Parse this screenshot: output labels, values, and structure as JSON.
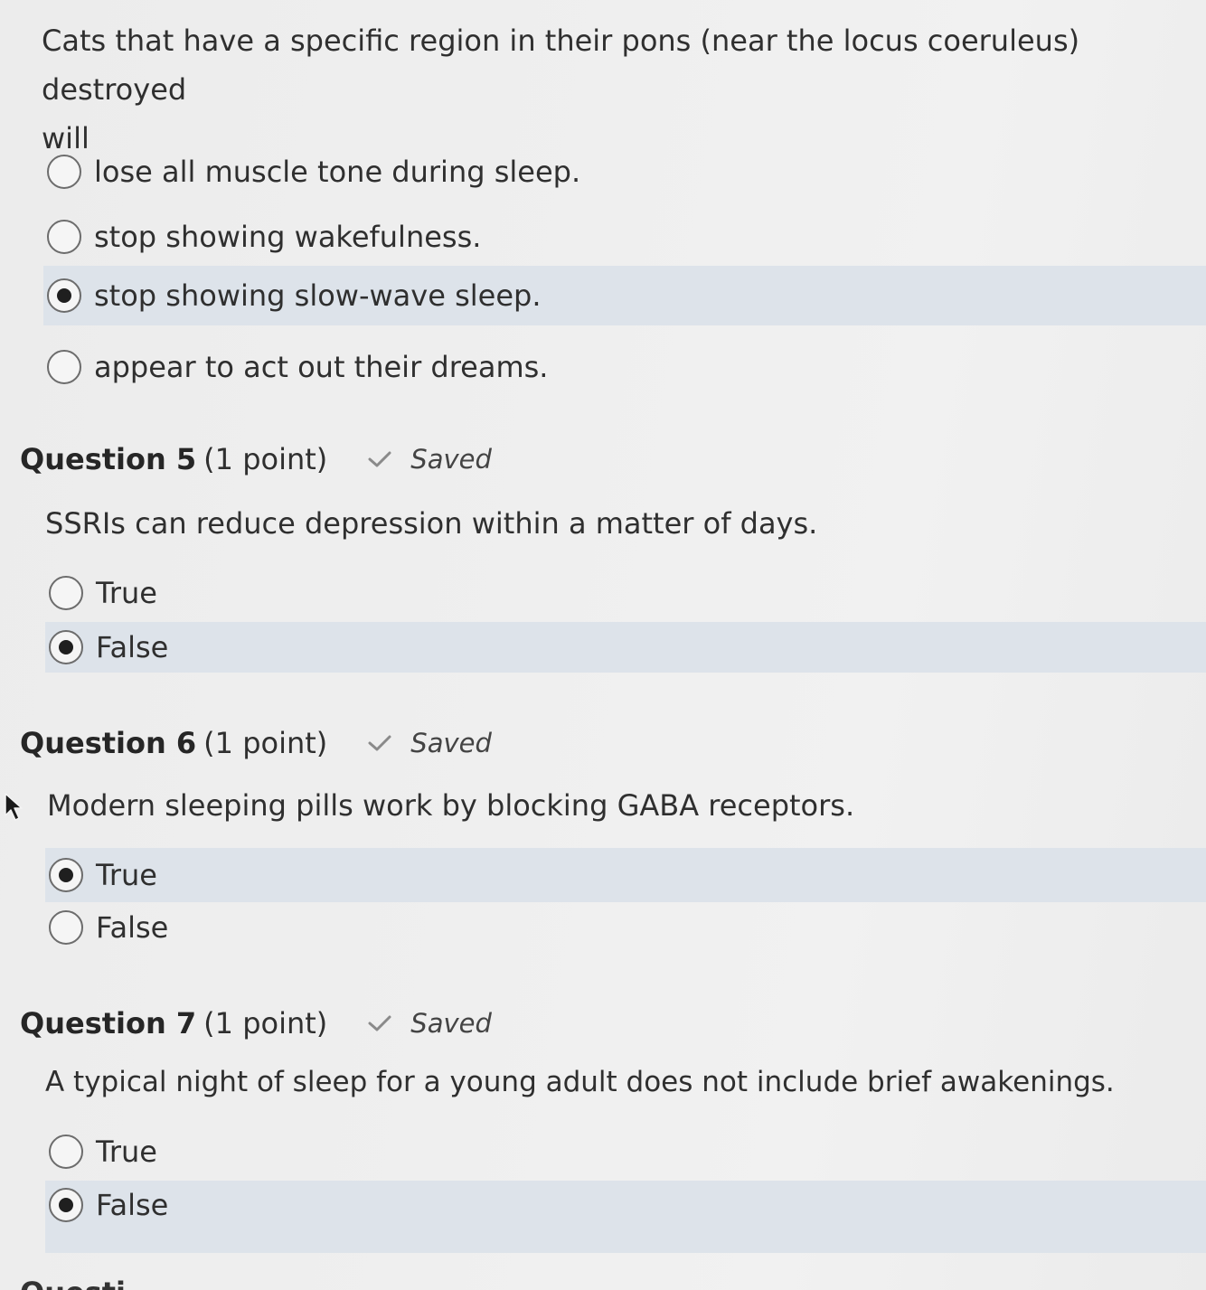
{
  "q4": {
    "prompt_line1": "Cats that have a specific region in their pons (near the locus coeruleus) destroyed",
    "prompt_line2": "will",
    "options": [
      {
        "label": "lose all muscle tone during sleep.",
        "selected": false
      },
      {
        "label": "stop showing wakefulness.",
        "selected": false
      },
      {
        "label": "stop showing slow-wave sleep.",
        "selected": true
      },
      {
        "label": "appear to act out their dreams.",
        "selected": false
      }
    ]
  },
  "q5": {
    "number": "Question 5",
    "points": "(1 point)",
    "status": "Saved",
    "prompt": "SSRIs can reduce depression within a matter of days.",
    "options": [
      {
        "label": "True",
        "selected": false
      },
      {
        "label": "False",
        "selected": true
      }
    ]
  },
  "q6": {
    "number": "Question 6",
    "points": "(1 point)",
    "status": "Saved",
    "prompt": "Modern sleeping pills work by blocking GABA receptors.",
    "options": [
      {
        "label": "True",
        "selected": true
      },
      {
        "label": "False",
        "selected": false
      }
    ]
  },
  "q7": {
    "number": "Question 7",
    "points": "(1 point)",
    "status": "Saved",
    "prompt": "A typical night of sleep for a young adult does not include brief awakenings.",
    "options": [
      {
        "label": "True",
        "selected": false
      },
      {
        "label": "False",
        "selected": true
      }
    ]
  },
  "next_peek": "Questi",
  "icons": {
    "saved_check": "check-icon",
    "radio_selected": "radio-selected",
    "radio_empty": "radio-empty",
    "mouse_cursor": "cursor-arrow-icon"
  },
  "colors": {
    "selected_row": "#dde3ea",
    "background": "#ececec",
    "text": "#2f2f2f"
  }
}
